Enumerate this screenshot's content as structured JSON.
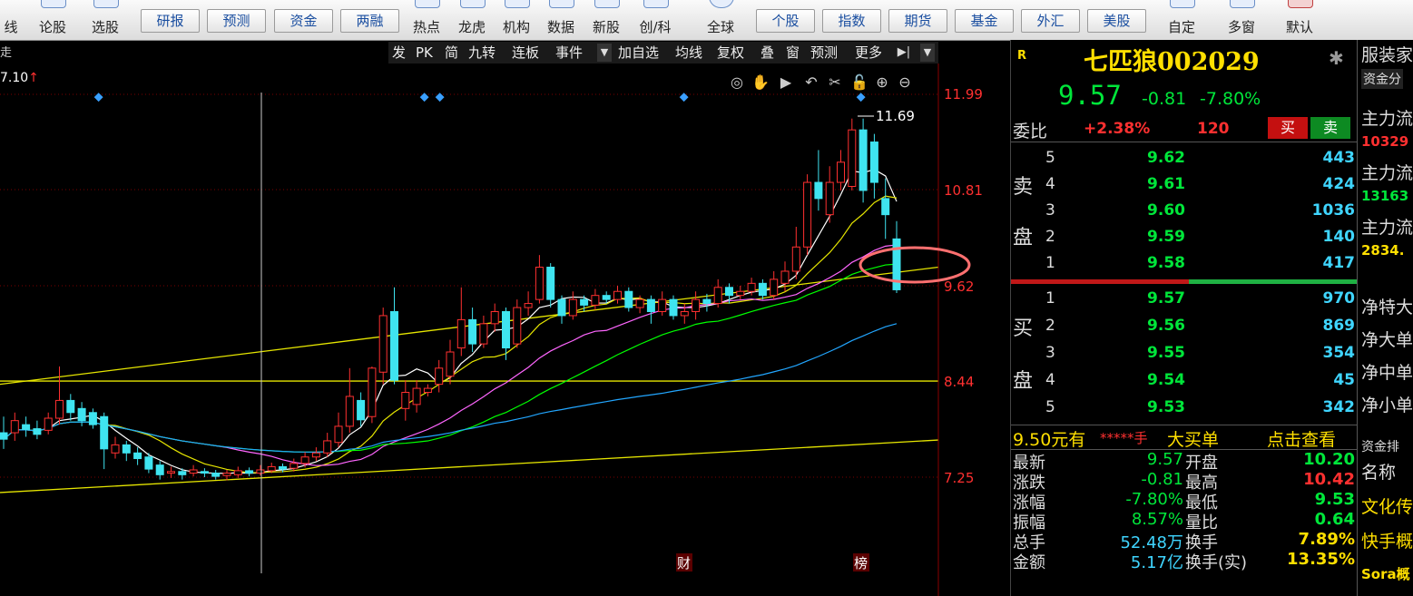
{
  "toolbar": {
    "icon_items": [
      {
        "label": "线",
        "icon": "line-chart-icon"
      },
      {
        "label": "论股",
        "icon": "forum-icon"
      },
      {
        "label": "选股",
        "icon": "stock-pick-icon"
      },
      {
        "label": "热点",
        "icon": "hot-icon"
      },
      {
        "label": "龙虎",
        "icon": "dragon-tiger-icon"
      },
      {
        "label": "机构",
        "icon": "institution-icon"
      },
      {
        "label": "数据",
        "icon": "data-icon"
      },
      {
        "label": "新股",
        "icon": "new-stock-icon"
      },
      {
        "label": "创/科",
        "icon": "star-market-icon"
      },
      {
        "label": "全球",
        "icon": "globe-icon"
      },
      {
        "label": "自定",
        "icon": "custom-icon"
      },
      {
        "label": "多窗",
        "icon": "multi-window-icon"
      },
      {
        "label": "默认",
        "icon": "default-icon"
      }
    ],
    "buttons": [
      "研报",
      "预测",
      "资金",
      "两融",
      "个股",
      "指数",
      "期货",
      "基金",
      "外汇",
      "美股"
    ]
  },
  "chart_toolbar": {
    "items": [
      "发",
      "PK",
      "简",
      "九转",
      "连板",
      "事件",
      "加自选",
      "均线",
      "复权",
      "叠",
      "窗",
      "预测",
      "更多"
    ]
  },
  "chart_left_tag": "走",
  "ma_value": "7.10",
  "ma_arrow": "↑",
  "chart_tool_icons": [
    "eye-icon",
    "hand-icon",
    "play-icon",
    "undo-icon",
    "scissors-icon",
    "lock-icon",
    "zoom-in-icon",
    "zoom-out-icon"
  ],
  "price_axis": [
    "11.99",
    "10.81",
    "9.62",
    "8.44",
    "7.25"
  ],
  "high_label": "11.69",
  "event_tags": [
    "财",
    "榜"
  ],
  "chart_data": {
    "type": "candlestick",
    "price_ticks": [
      11.99,
      10.81,
      9.62,
      8.44,
      7.25
    ],
    "high_annotation": 11.69,
    "candles": [
      {
        "o": 7.8,
        "c": 7.72,
        "h": 8.0,
        "l": 7.6
      },
      {
        "o": 7.8,
        "c": 7.95,
        "h": 8.05,
        "l": 7.7
      },
      {
        "o": 7.9,
        "c": 7.84,
        "h": 8.0,
        "l": 7.75
      },
      {
        "o": 7.85,
        "c": 7.78,
        "h": 7.95,
        "l": 7.72
      },
      {
        "o": 7.83,
        "c": 7.98,
        "h": 8.05,
        "l": 7.78
      },
      {
        "o": 7.98,
        "c": 8.2,
        "h": 8.62,
        "l": 7.9
      },
      {
        "o": 8.2,
        "c": 8.05,
        "h": 8.28,
        "l": 7.95
      },
      {
        "o": 8.1,
        "c": 7.95,
        "h": 8.18,
        "l": 7.88
      },
      {
        "o": 8.05,
        "c": 7.9,
        "h": 8.1,
        "l": 7.85
      },
      {
        "o": 8.0,
        "c": 7.6,
        "h": 8.05,
        "l": 7.35
      },
      {
        "o": 7.55,
        "c": 7.65,
        "h": 7.75,
        "l": 7.48
      },
      {
        "o": 7.65,
        "c": 7.55,
        "h": 7.7,
        "l": 7.45
      },
      {
        "o": 7.55,
        "c": 7.48,
        "h": 7.62,
        "l": 7.4
      },
      {
        "o": 7.5,
        "c": 7.35,
        "h": 7.55,
        "l": 7.3
      },
      {
        "o": 7.4,
        "c": 7.28,
        "h": 7.45,
        "l": 7.22
      },
      {
        "o": 7.3,
        "c": 7.32,
        "h": 7.38,
        "l": 7.24
      },
      {
        "o": 7.32,
        "c": 7.28,
        "h": 7.36,
        "l": 7.22
      },
      {
        "o": 7.3,
        "c": 7.34,
        "h": 7.4,
        "l": 7.26
      },
      {
        "o": 7.32,
        "c": 7.3,
        "h": 7.36,
        "l": 7.25
      },
      {
        "o": 7.3,
        "c": 7.26,
        "h": 7.34,
        "l": 7.22
      },
      {
        "o": 7.27,
        "c": 7.3,
        "h": 7.34,
        "l": 7.21
      },
      {
        "o": 7.28,
        "c": 7.33,
        "h": 7.38,
        "l": 7.24
      },
      {
        "o": 7.33,
        "c": 7.3,
        "h": 7.37,
        "l": 7.26
      },
      {
        "o": 7.3,
        "c": 7.34,
        "h": 7.4,
        "l": 7.27
      },
      {
        "o": 7.33,
        "c": 7.38,
        "h": 7.43,
        "l": 7.3
      },
      {
        "o": 7.38,
        "c": 7.35,
        "h": 7.42,
        "l": 7.31
      },
      {
        "o": 7.36,
        "c": 7.42,
        "h": 7.48,
        "l": 7.32
      },
      {
        "o": 7.42,
        "c": 7.5,
        "h": 7.56,
        "l": 7.37
      },
      {
        "o": 7.5,
        "c": 7.55,
        "h": 7.62,
        "l": 7.45
      },
      {
        "o": 7.55,
        "c": 7.7,
        "h": 7.8,
        "l": 7.5
      },
      {
        "o": 7.68,
        "c": 7.88,
        "h": 8.05,
        "l": 7.62
      },
      {
        "o": 7.88,
        "c": 8.25,
        "h": 8.6,
        "l": 7.8
      },
      {
        "o": 8.2,
        "c": 7.96,
        "h": 8.3,
        "l": 7.88
      },
      {
        "o": 8.0,
        "c": 8.6,
        "h": 8.62,
        "l": 7.92
      },
      {
        "o": 8.55,
        "c": 9.25,
        "h": 9.35,
        "l": 8.4
      },
      {
        "o": 9.3,
        "c": 8.45,
        "h": 9.6,
        "l": 8.4
      },
      {
        "o": 8.1,
        "c": 8.3,
        "h": 8.45,
        "l": 7.95
      },
      {
        "o": 8.15,
        "c": 8.35,
        "h": 8.45,
        "l": 8.05
      },
      {
        "o": 8.3,
        "c": 8.35,
        "h": 8.4,
        "l": 8.25
      },
      {
        "o": 8.4,
        "c": 8.6,
        "h": 8.7,
        "l": 8.3
      },
      {
        "o": 8.5,
        "c": 8.8,
        "h": 8.95,
        "l": 8.4
      },
      {
        "o": 8.85,
        "c": 9.2,
        "h": 9.6,
        "l": 8.75
      },
      {
        "o": 9.2,
        "c": 8.9,
        "h": 9.35,
        "l": 8.8
      },
      {
        "o": 8.9,
        "c": 9.15,
        "h": 9.25,
        "l": 8.85
      },
      {
        "o": 9.15,
        "c": 9.3,
        "h": 9.4,
        "l": 9.05
      },
      {
        "o": 9.3,
        "c": 8.85,
        "h": 9.35,
        "l": 8.7
      },
      {
        "o": 8.9,
        "c": 9.35,
        "h": 9.45,
        "l": 8.85
      },
      {
        "o": 9.35,
        "c": 9.4,
        "h": 9.55,
        "l": 9.25
      },
      {
        "o": 9.45,
        "c": 9.85,
        "h": 10.0,
        "l": 9.4
      },
      {
        "o": 9.85,
        "c": 9.45,
        "h": 9.9,
        "l": 9.35
      },
      {
        "o": 9.45,
        "c": 9.25,
        "h": 9.5,
        "l": 9.15
      },
      {
        "o": 9.25,
        "c": 9.45,
        "h": 9.55,
        "l": 9.2
      },
      {
        "o": 9.45,
        "c": 9.38,
        "h": 9.5,
        "l": 9.3
      },
      {
        "o": 9.38,
        "c": 9.5,
        "h": 9.58,
        "l": 9.32
      },
      {
        "o": 9.5,
        "c": 9.45,
        "h": 9.55,
        "l": 9.4
      },
      {
        "o": 9.45,
        "c": 9.55,
        "h": 9.62,
        "l": 9.4
      },
      {
        "o": 9.55,
        "c": 9.35,
        "h": 9.6,
        "l": 9.3
      },
      {
        "o": 9.35,
        "c": 9.45,
        "h": 9.5,
        "l": 9.28
      },
      {
        "o": 9.45,
        "c": 9.3,
        "h": 9.5,
        "l": 9.15
      },
      {
        "o": 9.3,
        "c": 9.45,
        "h": 9.55,
        "l": 9.25
      },
      {
        "o": 9.45,
        "c": 9.25,
        "h": 9.5,
        "l": 9.2
      },
      {
        "o": 9.25,
        "c": 9.3,
        "h": 9.4,
        "l": 9.15
      },
      {
        "o": 9.3,
        "c": 9.45,
        "h": 9.55,
        "l": 9.2
      },
      {
        "o": 9.45,
        "c": 9.4,
        "h": 9.52,
        "l": 9.3
      },
      {
        "o": 9.4,
        "c": 9.6,
        "h": 9.7,
        "l": 9.35
      },
      {
        "o": 9.6,
        "c": 9.5,
        "h": 9.65,
        "l": 9.4
      },
      {
        "o": 9.5,
        "c": 9.55,
        "h": 9.62,
        "l": 9.45
      },
      {
        "o": 9.55,
        "c": 9.65,
        "h": 9.72,
        "l": 9.5
      },
      {
        "o": 9.65,
        "c": 9.5,
        "h": 9.7,
        "l": 9.45
      },
      {
        "o": 9.5,
        "c": 9.7,
        "h": 9.8,
        "l": 9.45
      },
      {
        "o": 9.65,
        "c": 9.8,
        "h": 9.92,
        "l": 9.55
      },
      {
        "o": 9.8,
        "c": 10.1,
        "h": 10.35,
        "l": 9.7
      },
      {
        "o": 10.1,
        "c": 10.9,
        "h": 11.0,
        "l": 10.0
      },
      {
        "o": 10.9,
        "c": 10.7,
        "h": 11.3,
        "l": 10.55
      },
      {
        "o": 10.5,
        "c": 10.9,
        "h": 11.1,
        "l": 10.4
      },
      {
        "o": 10.9,
        "c": 11.15,
        "h": 11.3,
        "l": 10.8
      },
      {
        "o": 10.85,
        "c": 11.55,
        "h": 11.69,
        "l": 10.8
      },
      {
        "o": 11.55,
        "c": 10.8,
        "h": 11.69,
        "l": 10.65
      },
      {
        "o": 11.4,
        "c": 10.9,
        "h": 11.5,
        "l": 10.7
      },
      {
        "o": 10.7,
        "c": 10.5,
        "h": 10.95,
        "l": 10.2
      },
      {
        "o": 10.2,
        "c": 9.57,
        "h": 10.42,
        "l": 9.53
      }
    ]
  },
  "quote": {
    "mark": "R",
    "name": "七匹狼",
    "code": "002029",
    "price": "9.57",
    "change": "-0.81",
    "change_pct": "-7.80%",
    "weibi_label": "委比",
    "weibi_pct": "+2.38%",
    "weibi_diff": "120",
    "buy_label": "买",
    "sell_label": "卖",
    "sell_side_chars": [
      "卖",
      "盘"
    ],
    "buy_side_chars": [
      "买",
      "盘"
    ],
    "sell_orders": [
      {
        "lvl": "5",
        "price": "9.62",
        "vol": "443"
      },
      {
        "lvl": "4",
        "price": "9.61",
        "vol": "424"
      },
      {
        "lvl": "3",
        "price": "9.60",
        "vol": "1036"
      },
      {
        "lvl": "2",
        "price": "9.59",
        "vol": "140"
      },
      {
        "lvl": "1",
        "price": "9.58",
        "vol": "417"
      }
    ],
    "buy_orders": [
      {
        "lvl": "1",
        "price": "9.57",
        "vol": "970"
      },
      {
        "lvl": "2",
        "price": "9.56",
        "vol": "869"
      },
      {
        "lvl": "3",
        "price": "9.55",
        "vol": "354"
      },
      {
        "lvl": "4",
        "price": "9.54",
        "vol": "45"
      },
      {
        "lvl": "5",
        "price": "9.53",
        "vol": "342"
      }
    ],
    "big_order_price": "9.50元有",
    "big_order_mask": "*****手",
    "big_order_type": "大买单",
    "big_order_link": "点击查看",
    "stats_left": [
      {
        "k": "最新",
        "v": "9.57"
      },
      {
        "k": "涨跌",
        "v": "-0.81"
      },
      {
        "k": "涨幅",
        "v": "-7.80%"
      },
      {
        "k": "振幅",
        "v": "8.57%"
      },
      {
        "k": "总手",
        "v": "52.48万"
      },
      {
        "k": "金额",
        "v": "5.17亿"
      }
    ],
    "stats_right": [
      {
        "k": "开盘",
        "v": "10.20"
      },
      {
        "k": "最高",
        "v": "10.42"
      },
      {
        "k": "最低",
        "v": "9.53"
      },
      {
        "k": "量比",
        "v": "0.64"
      },
      {
        "k": "换手",
        "v": "7.89%"
      },
      {
        "k": "换手(实)",
        "v": "13.35%"
      }
    ]
  },
  "far_panel": {
    "title": "服装家",
    "tab": "资金分",
    "items": [
      {
        "k": "主力流",
        "v": "10329"
      },
      {
        "k": "主力流",
        "v": "13163"
      },
      {
        "k": "主力流",
        "v": "2834."
      }
    ],
    "net": [
      "净特大",
      "净大单",
      "净中单",
      "净小单"
    ],
    "rank_title": "资金排",
    "name_header": "名称",
    "rank_items": [
      "文化传",
      "快手概",
      "Sora概"
    ]
  },
  "colors": {
    "up": "#ff3030",
    "down": "#3fe4f0",
    "ma5": "#ffffff",
    "ma10": "#e6e600",
    "ma20": "#ff66ff",
    "ma30": "#00ff00",
    "ma60": "#22a6ff",
    "trend": "#e6e600",
    "highlight": "#ff7070"
  }
}
